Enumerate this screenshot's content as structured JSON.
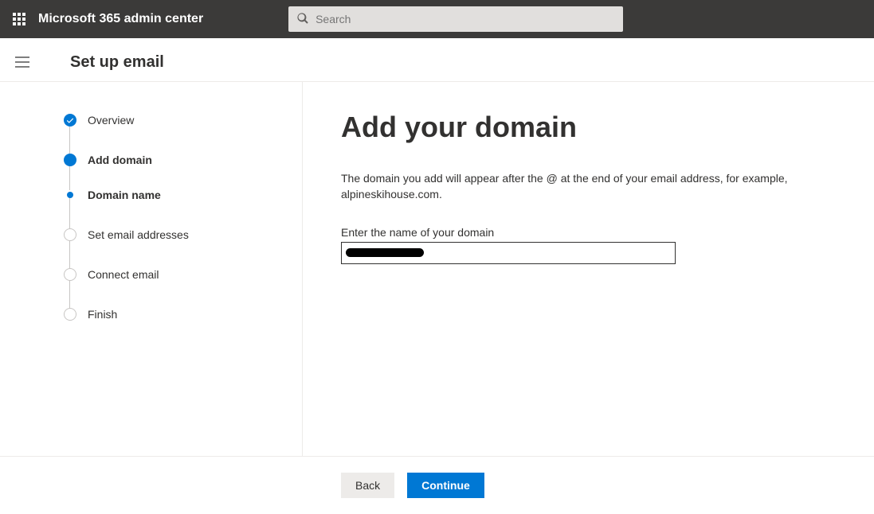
{
  "header": {
    "app_title": "Microsoft 365 admin center",
    "search_placeholder": "Search"
  },
  "page": {
    "title": "Set up email"
  },
  "steps": [
    {
      "label": "Overview",
      "state": "done"
    },
    {
      "label": "Add domain",
      "state": "current",
      "substeps": [
        {
          "label": "Domain name",
          "state": "current"
        }
      ]
    },
    {
      "label": "Set email addresses",
      "state": "pending"
    },
    {
      "label": "Connect email",
      "state": "pending"
    },
    {
      "label": "Finish",
      "state": "pending"
    }
  ],
  "content": {
    "heading": "Add your domain",
    "description": "The domain you add will appear after the @ at the end of your email address, for example, alpineskihouse.com.",
    "domain_field_label": "Enter the name of your domain",
    "domain_value": ""
  },
  "footer": {
    "back": "Back",
    "continue": "Continue"
  },
  "colors": {
    "accent": "#0078d4",
    "topbar": "#3b3a39"
  }
}
